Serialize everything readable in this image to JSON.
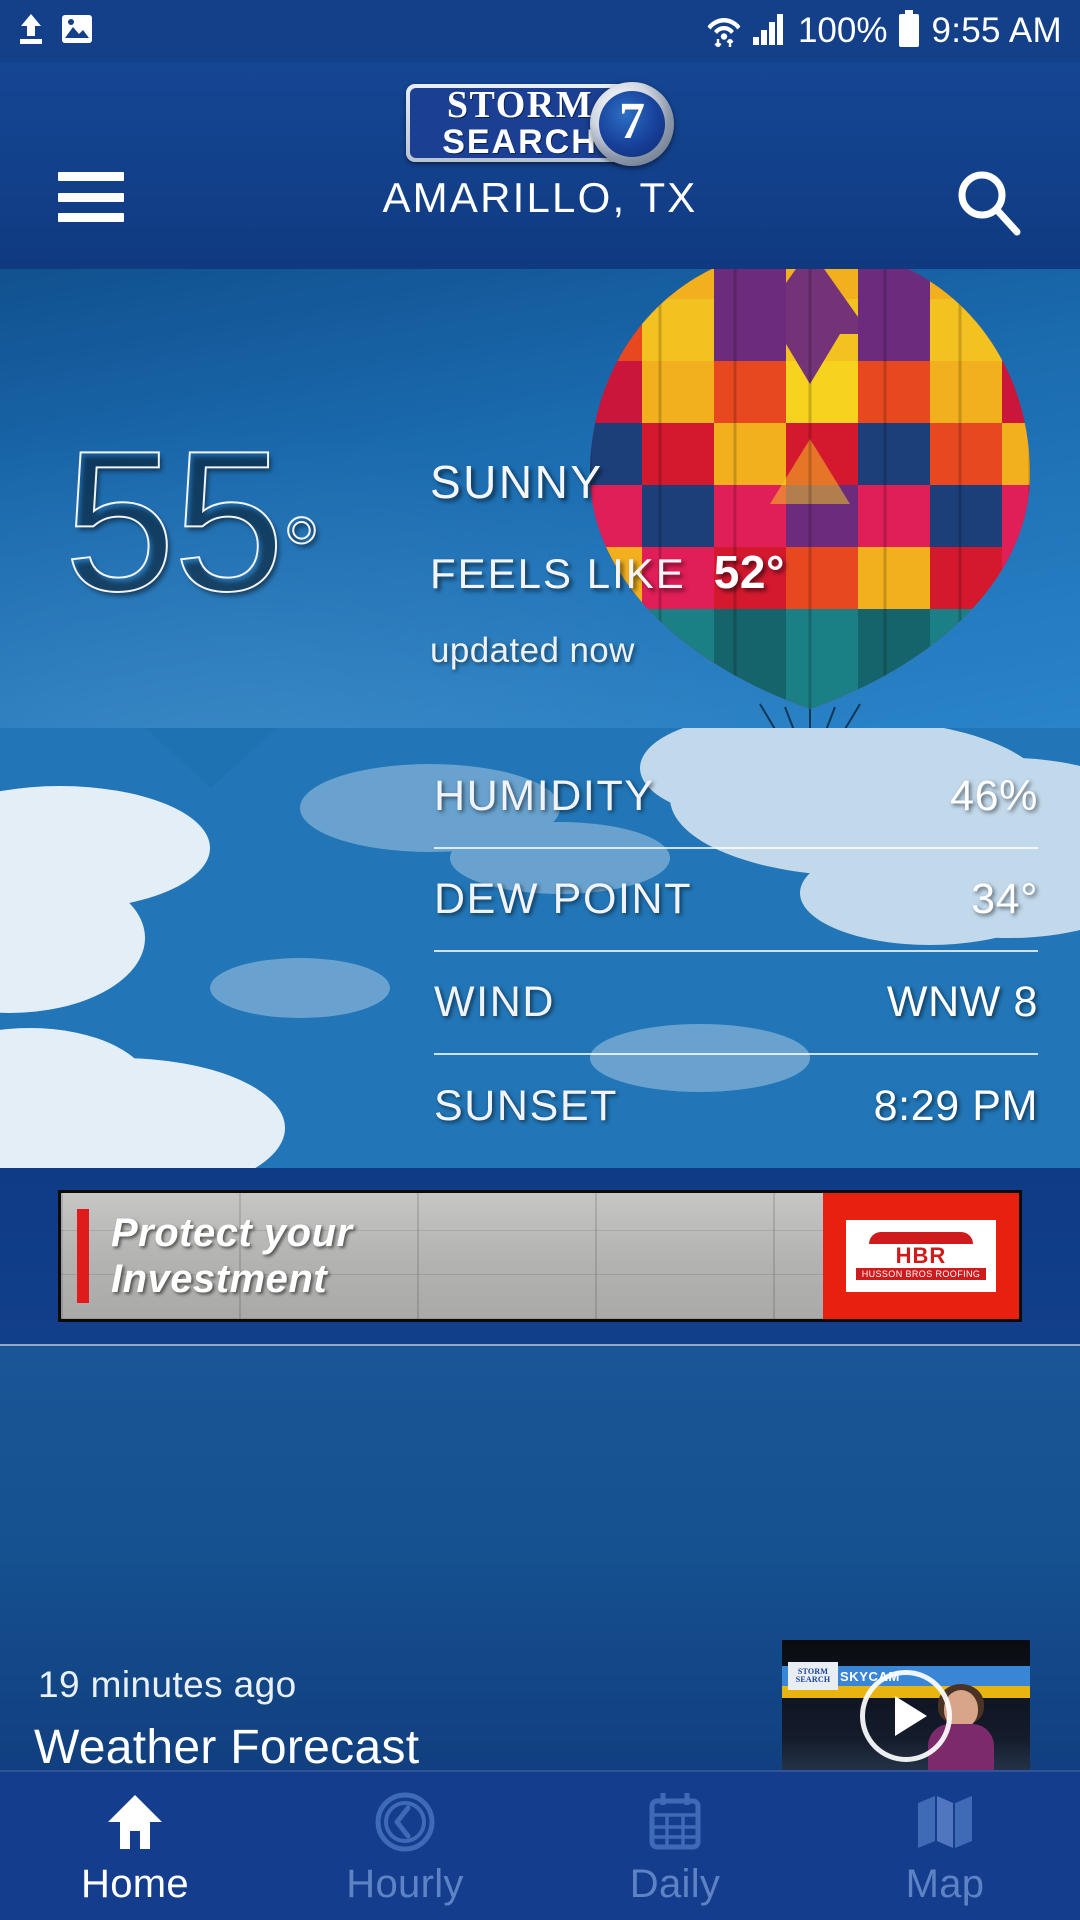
{
  "statusbar": {
    "upload_icon": "upload-icon",
    "image_icon": "image-icon",
    "wifi_icon": "wifi-transfer-icon",
    "signal_icon": "cellular-signal-icon",
    "battery_percent": "100%",
    "battery_icon": "battery-full-icon",
    "time": "9:55 AM"
  },
  "header": {
    "menu_icon": "hamburger-menu-icon",
    "search_icon": "search-icon",
    "logo_storm": "STORM",
    "logo_search": "SEARCH",
    "logo_number": "7",
    "city": "AMARILLO, TX"
  },
  "hero": {
    "temperature": "55",
    "degree": "°",
    "condition": "SUNNY",
    "feels_like_label": "FEELS LIKE",
    "feels_like_value": "52°",
    "updated": "updated now"
  },
  "details": {
    "icon": "sun-icon",
    "rows": [
      {
        "label": "HUMIDITY",
        "value": "46%"
      },
      {
        "label": "DEW POINT",
        "value": "34°"
      },
      {
        "label": "WIND",
        "value": "WNW 8"
      },
      {
        "label": "SUNSET",
        "value": "8:29 PM"
      }
    ]
  },
  "ad": {
    "line1": "Protect your",
    "line2": "Investment",
    "brand": "HBR",
    "brand_sub": "HUSSON BROS ROOFING"
  },
  "news": {
    "timestamp": "19 minutes ago",
    "title": "Weather Forecast",
    "thumb_logo_top": "STORM",
    "thumb_logo_bottom": "SEARCH",
    "thumb_badge": "SKYCAM",
    "play_icon": "play-icon"
  },
  "bottomnav": [
    {
      "label": "Home",
      "icon": "home-icon",
      "active": true
    },
    {
      "label": "Hourly",
      "icon": "clock-icon",
      "active": false
    },
    {
      "label": "Daily",
      "icon": "calendar-icon",
      "active": false
    },
    {
      "label": "Map",
      "icon": "map-icon",
      "active": false
    }
  ],
  "colors": {
    "header_blue": "#134088",
    "hero_blue": "#1d72bb",
    "panel_blue": "#2478b9",
    "nav_blue": "#143d8e",
    "sun_yellow": "#F5B612",
    "ad_red": "#e8200f",
    "nav_dim": "#5e83c4"
  }
}
